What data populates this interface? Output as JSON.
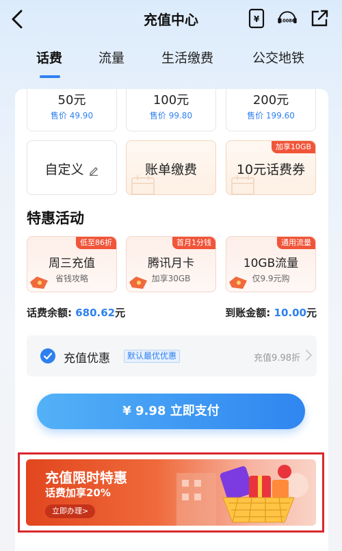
{
  "header": {
    "title": "充值中心",
    "cs_label": "10086"
  },
  "tabs": [
    {
      "label": "话费",
      "active": true
    },
    {
      "label": "流量",
      "active": false
    },
    {
      "label": "生活缴费",
      "active": false
    },
    {
      "label": "公交地铁",
      "active": false
    }
  ],
  "amounts": [
    {
      "value": "50元",
      "price": "售价 49.90"
    },
    {
      "value": "100元",
      "price": "售价 99.80"
    },
    {
      "value": "200元",
      "price": "售价 199.60"
    }
  ],
  "options": [
    {
      "label": "自定义"
    },
    {
      "label": "账单缴费"
    },
    {
      "label": "10元话费券",
      "tag": "加享10GB"
    }
  ],
  "section_title": "特惠活动",
  "promos": [
    {
      "title": "周三充值",
      "sub": "省钱攻略",
      "tag": "低至86折"
    },
    {
      "title": "腾讯月卡",
      "sub": "加享30GB",
      "tag": "首月1分钱"
    },
    {
      "title": "10GB流量",
      "sub": "仅9.9元购",
      "tag": "通用流量"
    }
  ],
  "balance": {
    "left_label": "话费余额:",
    "left_value": "680.62",
    "left_unit": "元",
    "right_label": "到账金额:",
    "right_value": "10.00",
    "right_unit": "元"
  },
  "discount": {
    "label": "充值优惠",
    "badge": "默认最优优惠",
    "value": "充值9.98折"
  },
  "pay_button": "¥ 9.98  立即支付",
  "banner": {
    "title": "充值限时特惠",
    "sub": "话费加享20%",
    "button": "立即办理>"
  },
  "colors": {
    "accent": "#2e80f0",
    "tag_red": "#f0553a",
    "highlight_frame": "#d9262c"
  }
}
